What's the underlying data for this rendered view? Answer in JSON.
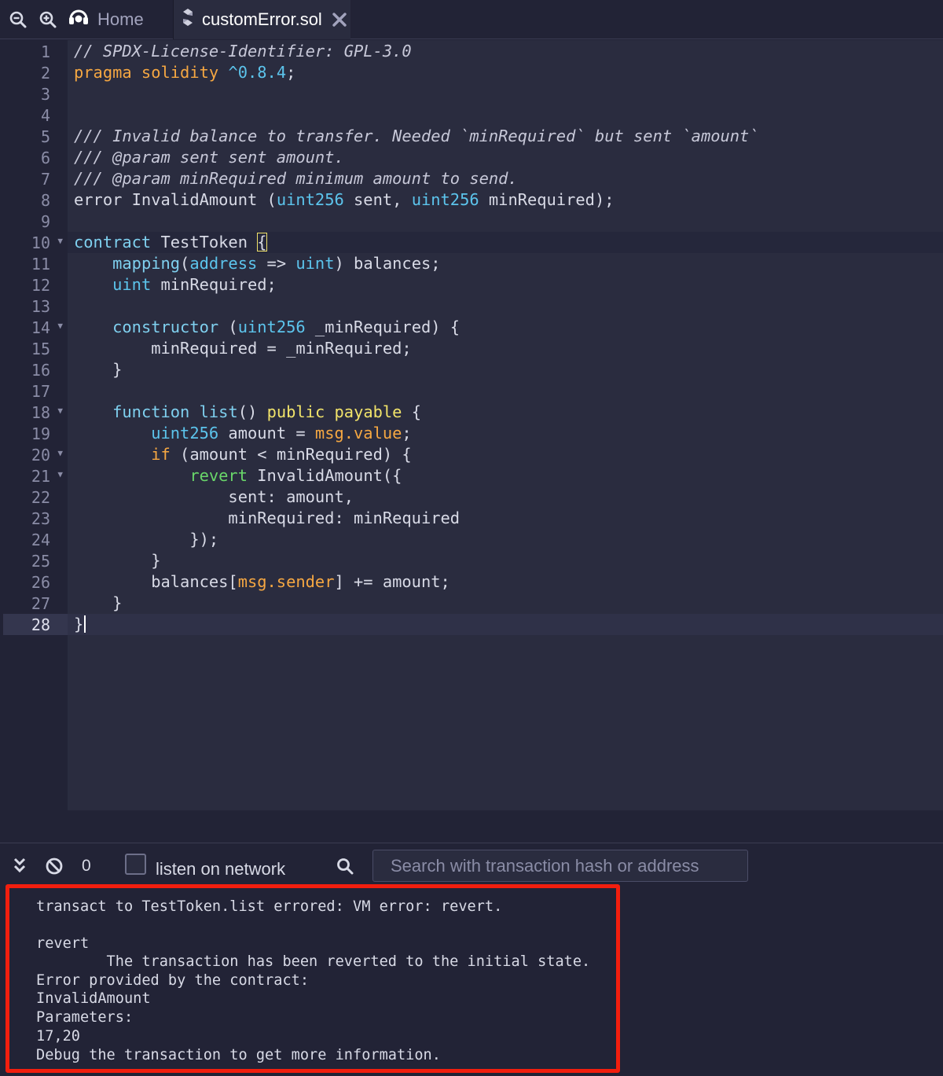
{
  "tabbar": {
    "zoom_out_icon": "zoom-out-icon",
    "zoom_in_icon": "zoom-in-icon",
    "home_tab": {
      "icon": "remix-logo-icon",
      "label": "Home"
    },
    "file_tab": {
      "icon": "solidity-icon",
      "label": "customError.sol",
      "close_icon": "close-icon"
    }
  },
  "editor": {
    "active_line": 28,
    "folded_markers": [
      10,
      14,
      18,
      20,
      21
    ],
    "lines": [
      {
        "n": "1",
        "parts": [
          [
            "cm",
            "// SPDX-License-Identifier: GPL-3.0"
          ]
        ]
      },
      {
        "n": "2",
        "parts": [
          [
            "or",
            "pragma solidity"
          ],
          [
            "pl",
            " "
          ],
          [
            "nm",
            "^0.8.4"
          ],
          [
            "pl",
            ";"
          ]
        ]
      },
      {
        "n": "3",
        "parts": []
      },
      {
        "n": "4",
        "parts": []
      },
      {
        "n": "5",
        "parts": [
          [
            "cm",
            "/// Invalid balance to transfer. Needed `minRequired` but sent `amount`"
          ]
        ]
      },
      {
        "n": "6",
        "parts": [
          [
            "cm",
            "/// @param sent sent amount."
          ]
        ]
      },
      {
        "n": "7",
        "parts": [
          [
            "cm",
            "/// @param minRequired minimum amount to send."
          ]
        ]
      },
      {
        "n": "8",
        "parts": [
          [
            "pl",
            "error InvalidAmount ("
          ],
          [
            "ty",
            "uint256"
          ],
          [
            "pl",
            " sent, "
          ],
          [
            "ty",
            "uint256"
          ],
          [
            "pl",
            " minRequired);"
          ]
        ]
      },
      {
        "n": "9",
        "parts": []
      },
      {
        "n": "10",
        "parts": [
          [
            "kw",
            "contract"
          ],
          [
            "pl",
            " TestToken "
          ],
          [
            "bm",
            "{"
          ]
        ]
      },
      {
        "n": "11",
        "parts": [
          [
            "pl",
            "    "
          ],
          [
            "kw",
            "mapping"
          ],
          [
            "pl",
            "("
          ],
          [
            "ty",
            "address"
          ],
          [
            "pl",
            " => "
          ],
          [
            "ty",
            "uint"
          ],
          [
            "pl",
            ") balances;"
          ]
        ]
      },
      {
        "n": "12",
        "parts": [
          [
            "pl",
            "    "
          ],
          [
            "ty",
            "uint"
          ],
          [
            "pl",
            " minRequired;"
          ]
        ]
      },
      {
        "n": "13",
        "parts": []
      },
      {
        "n": "14",
        "parts": [
          [
            "pl",
            "    "
          ],
          [
            "kw",
            "constructor"
          ],
          [
            "pl",
            " ("
          ],
          [
            "ty",
            "uint256"
          ],
          [
            "pl",
            " _minRequired) {"
          ]
        ]
      },
      {
        "n": "15",
        "parts": [
          [
            "pl",
            "        minRequired = _minRequired;"
          ]
        ]
      },
      {
        "n": "16",
        "parts": [
          [
            "pl",
            "    }"
          ]
        ]
      },
      {
        "n": "17",
        "parts": []
      },
      {
        "n": "18",
        "parts": [
          [
            "pl",
            "    "
          ],
          [
            "kw",
            "function"
          ],
          [
            "pl",
            " "
          ],
          [
            "kw",
            "list"
          ],
          [
            "pl",
            "() "
          ],
          [
            "ye",
            "public"
          ],
          [
            "pl",
            " "
          ],
          [
            "ye",
            "payable"
          ],
          [
            "pl",
            " {"
          ]
        ]
      },
      {
        "n": "19",
        "parts": [
          [
            "pl",
            "        "
          ],
          [
            "ty",
            "uint256"
          ],
          [
            "pl",
            " amount = "
          ],
          [
            "or",
            "msg.value"
          ],
          [
            "pl",
            ";"
          ]
        ]
      },
      {
        "n": "20",
        "parts": [
          [
            "pl",
            "        "
          ],
          [
            "or",
            "if"
          ],
          [
            "pl",
            " (amount < minRequired) {"
          ]
        ]
      },
      {
        "n": "21",
        "parts": [
          [
            "pl",
            "            "
          ],
          [
            "gr",
            "revert"
          ],
          [
            "pl",
            " InvalidAmount({"
          ]
        ]
      },
      {
        "n": "22",
        "parts": [
          [
            "pl",
            "                sent: amount,"
          ]
        ]
      },
      {
        "n": "23",
        "parts": [
          [
            "pl",
            "                minRequired: minRequired"
          ]
        ]
      },
      {
        "n": "24",
        "parts": [
          [
            "pl",
            "            });"
          ]
        ]
      },
      {
        "n": "25",
        "parts": [
          [
            "pl",
            "        }"
          ]
        ]
      },
      {
        "n": "26",
        "parts": [
          [
            "pl",
            "        balances["
          ],
          [
            "or",
            "msg.sender"
          ],
          [
            "pl",
            "] += amount;"
          ]
        ]
      },
      {
        "n": "27",
        "parts": [
          [
            "pl",
            "    }"
          ]
        ]
      },
      {
        "n": "28",
        "parts": [
          [
            "pl",
            "}"
          ]
        ]
      }
    ]
  },
  "terminal": {
    "toolbar": {
      "collapse_icon": "double-chevron-down-icon",
      "clear_icon": "ban-icon",
      "pending_count": "0",
      "listen_label": "listen on network",
      "search_icon": "search-icon",
      "search_placeholder": "Search with transaction hash or address"
    },
    "output": [
      "transact to TestToken.list errored: VM error: revert.",
      "",
      "revert",
      "        The transaction has been reverted to the initial state.",
      "Error provided by the contract:",
      "InvalidAmount",
      "Parameters:",
      "17,20",
      "Debug the transaction to get more information."
    ],
    "highlight_color": "#f21e0e"
  }
}
